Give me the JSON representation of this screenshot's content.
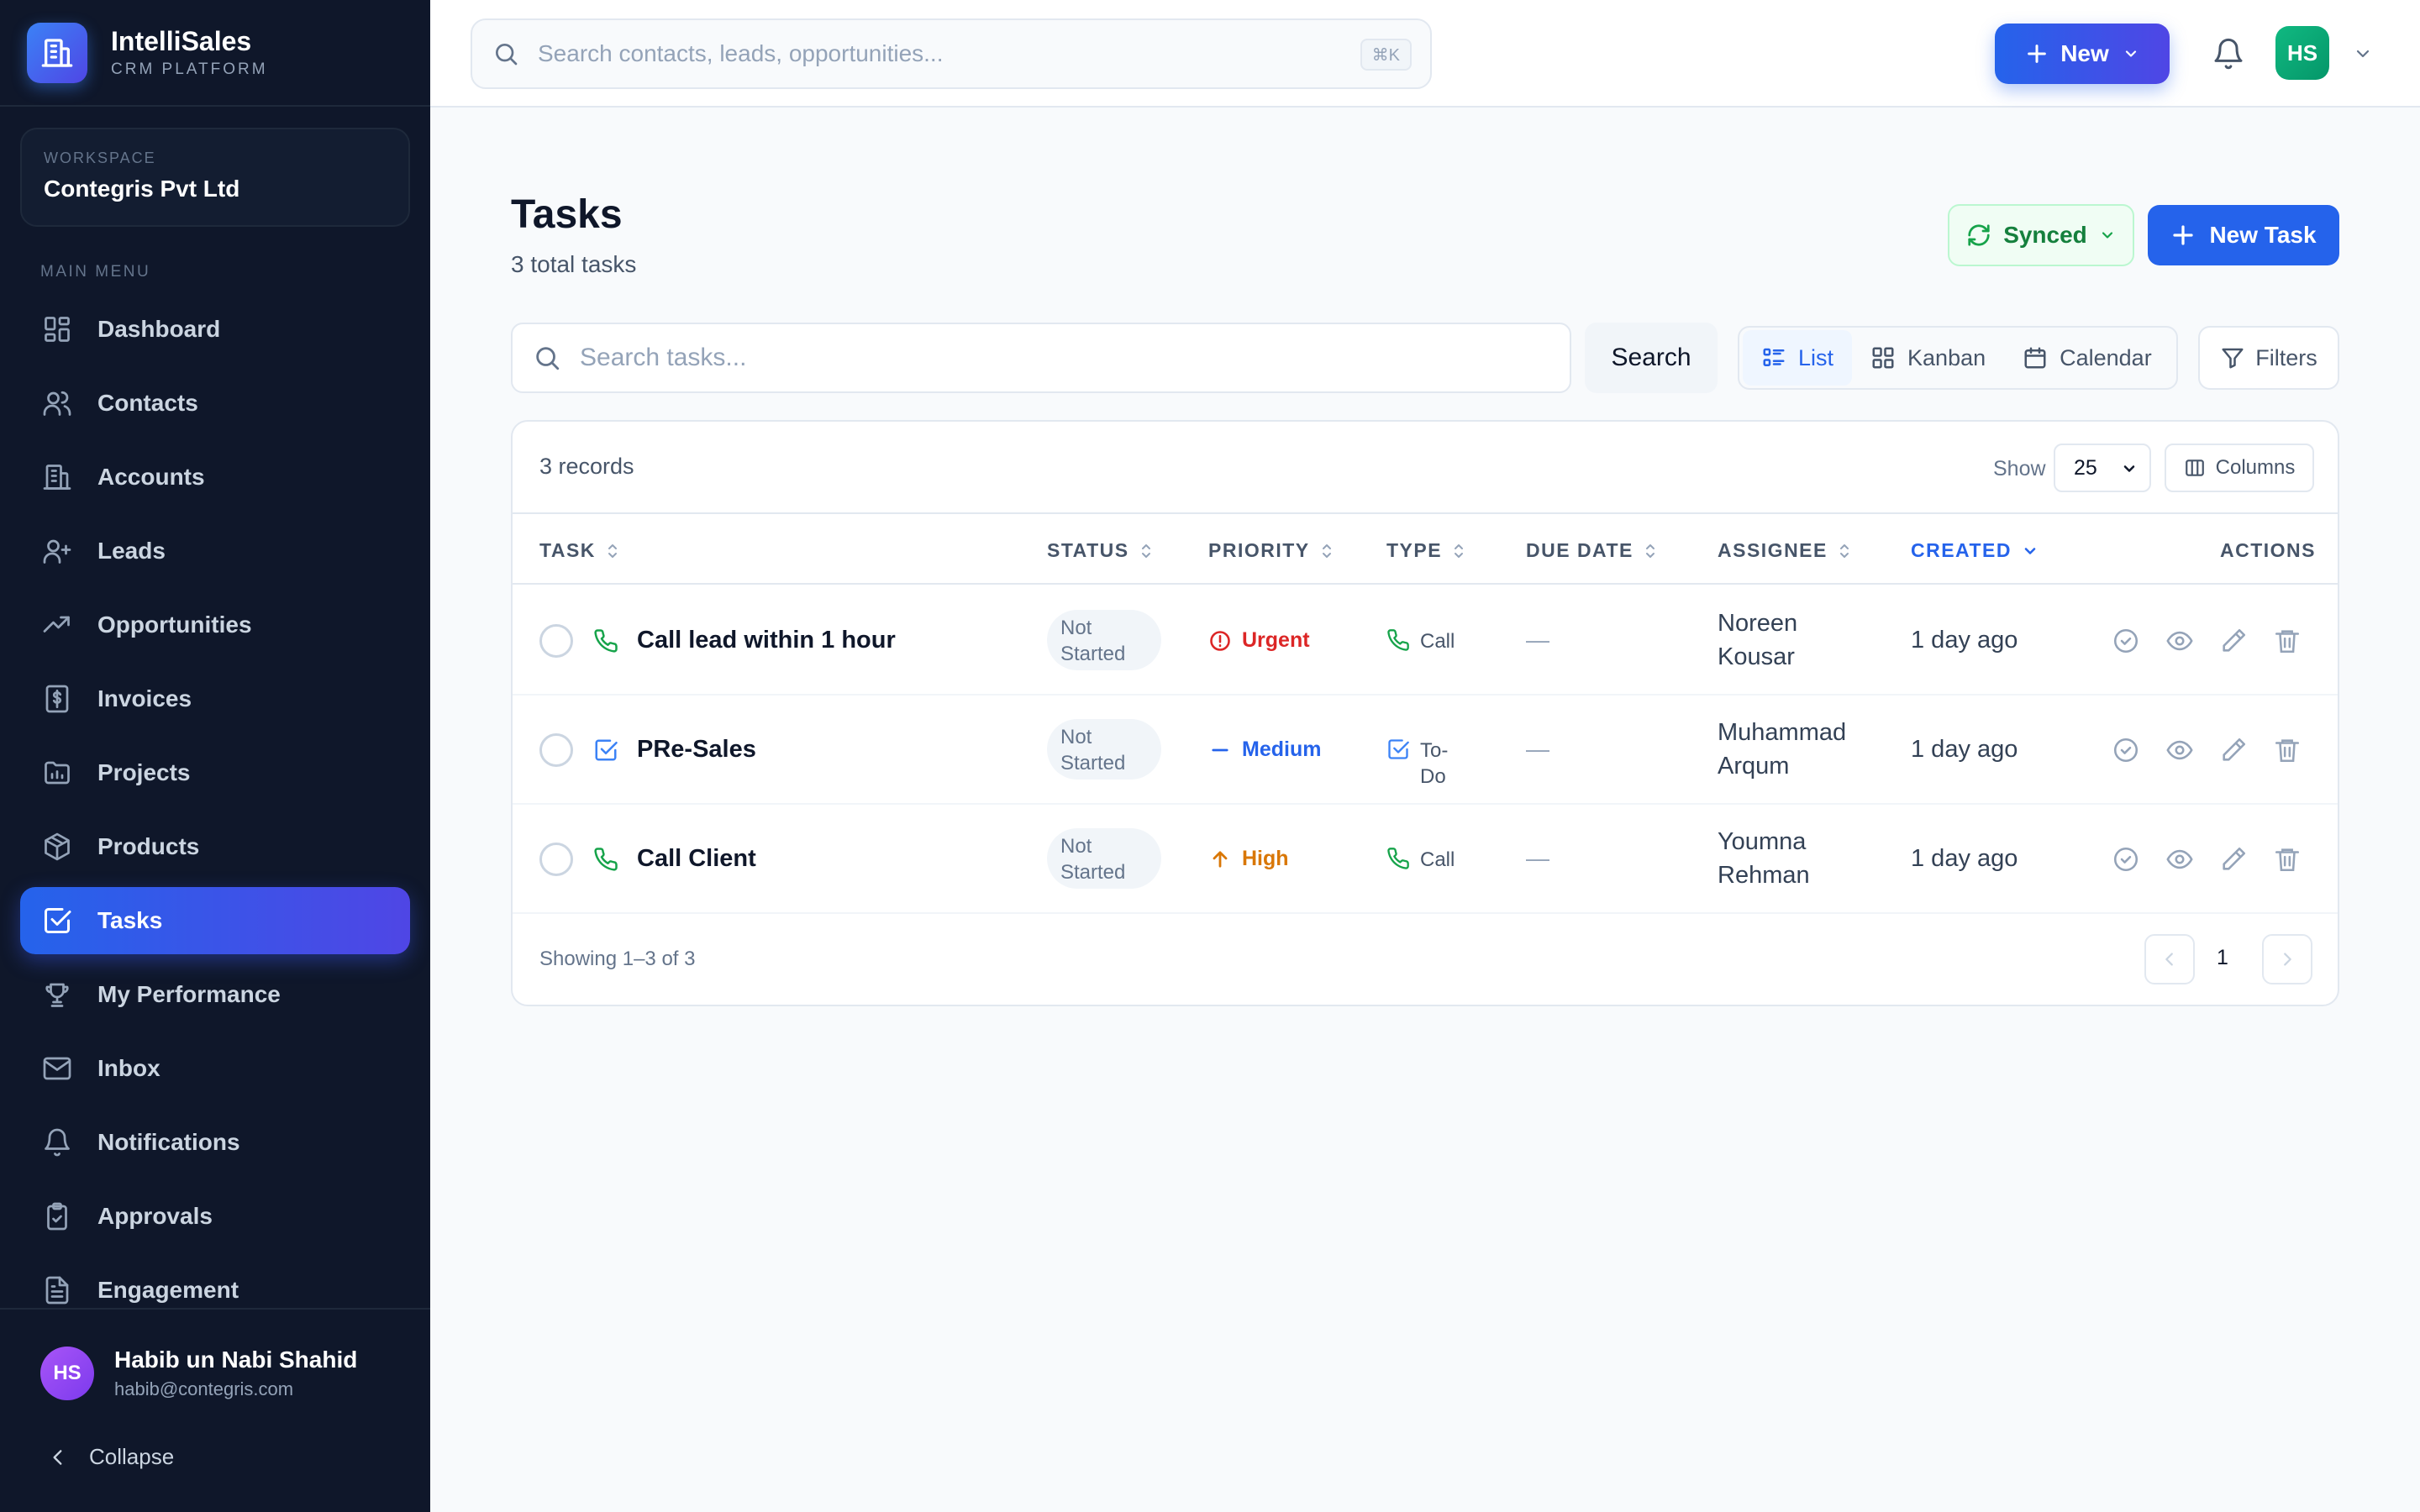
{
  "brand": {
    "name": "IntelliSales",
    "subtitle": "CRM PLATFORM",
    "icon": "building-icon"
  },
  "workspace": {
    "label": "WORKSPACE",
    "name": "Contegris Pvt Ltd"
  },
  "sidebar": {
    "menu_label": "MAIN MENU",
    "items": [
      {
        "label": "Dashboard",
        "icon": "dashboard-icon"
      },
      {
        "label": "Contacts",
        "icon": "contacts-icon"
      },
      {
        "label": "Accounts",
        "icon": "building-icon"
      },
      {
        "label": "Leads",
        "icon": "user-plus-icon"
      },
      {
        "label": "Opportunities",
        "icon": "trending-up-icon"
      },
      {
        "label": "Invoices",
        "icon": "invoice-icon"
      },
      {
        "label": "Projects",
        "icon": "folder-chart-icon"
      },
      {
        "label": "Products",
        "icon": "box-icon"
      },
      {
        "label": "Tasks",
        "icon": "checkbox-icon",
        "active": true
      },
      {
        "label": "My Performance",
        "icon": "trophy-icon"
      },
      {
        "label": "Inbox",
        "icon": "mail-icon"
      },
      {
        "label": "Notifications",
        "icon": "bell-icon"
      },
      {
        "label": "Approvals",
        "icon": "clipboard-check-icon"
      },
      {
        "label": "Engagement",
        "icon": "document-icon"
      }
    ],
    "collapse_label": "Collapse"
  },
  "user": {
    "initials": "HS",
    "name": "Habib un Nabi Shahid",
    "email": "habib@contegris.com"
  },
  "topbar": {
    "search_placeholder": "Search contacts, leads, opportunities...",
    "shortcut": "⌘K",
    "new_label": "New",
    "avatar_initials": "HS"
  },
  "page": {
    "title": "Tasks",
    "subtitle": "3 total tasks",
    "synced_label": "Synced",
    "new_task_label": "New Task"
  },
  "toolbar": {
    "search_placeholder": "Search tasks...",
    "search_button": "Search",
    "views": [
      "List",
      "Kanban",
      "Calendar"
    ],
    "active_view": "List",
    "filters_label": "Filters"
  },
  "table": {
    "records_label": "3 records",
    "show_label": "Show",
    "page_size": "25",
    "columns_label": "Columns",
    "headers": {
      "task": "TASK",
      "status": "STATUS",
      "priority": "PRIORITY",
      "type": "TYPE",
      "due_date": "DUE DATE",
      "assignee": "ASSIGNEE",
      "created": "CREATED",
      "actions": "ACTIONS"
    },
    "sorted_by": "CREATED",
    "rows": [
      {
        "task": "Call lead within 1 hour",
        "task_icon": "phone-icon",
        "status": "Not Started",
        "priority": "Urgent",
        "priority_color": "#dc2626",
        "priority_icon": "alert-circle-icon",
        "type": "Call",
        "type_icon": "phone-icon",
        "due_date": "—",
        "assignee": "Noreen Kousar",
        "created": "1 day ago"
      },
      {
        "task": "PRe-Sales",
        "task_icon": "checkbox-icon",
        "status": "Not Started",
        "priority": "Medium",
        "priority_color": "#2563eb",
        "priority_icon": "minus-icon",
        "type": "To-Do",
        "type_icon": "checkbox-icon",
        "due_date": "—",
        "assignee": "Muhammad Arqum",
        "created": "1 day ago"
      },
      {
        "task": "Call Client",
        "task_icon": "phone-icon",
        "status": "Not Started",
        "priority": "High",
        "priority_color": "#d97706",
        "priority_icon": "arrow-up-icon",
        "type": "Call",
        "type_icon": "phone-icon",
        "due_date": "—",
        "assignee": "Youmna Rehman",
        "created": "1 day ago"
      }
    ],
    "showing_label": "Showing 1–3 of 3",
    "current_page": "1"
  },
  "colors": {
    "accent": "#2563eb",
    "sidebar_bg": "#0f172a",
    "success": "#16a34a"
  }
}
